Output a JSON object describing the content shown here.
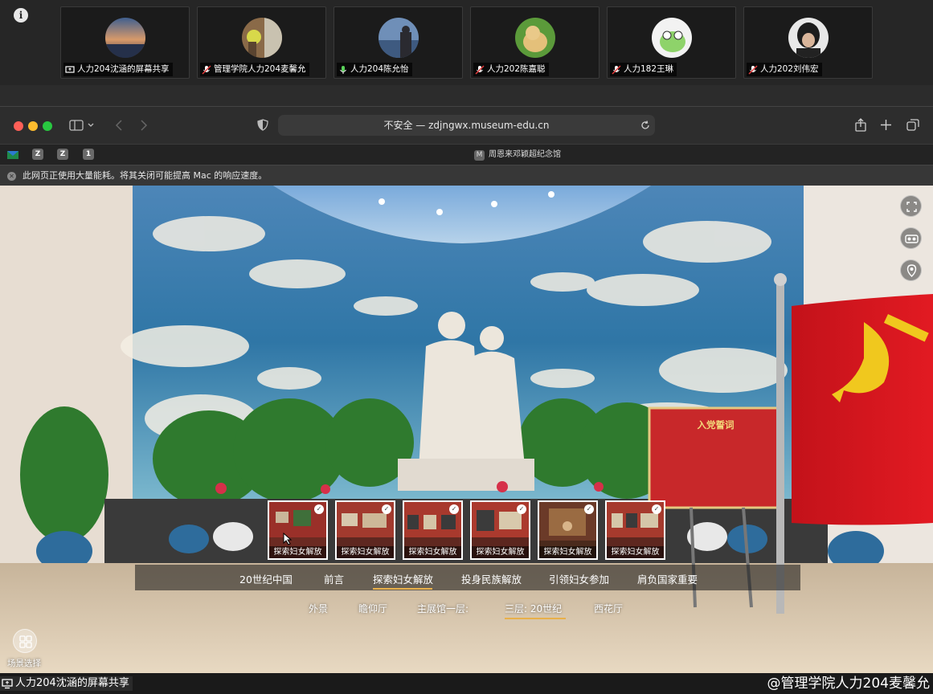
{
  "meeting": {
    "info_icon": "info-icon",
    "participants": [
      {
        "name": "人力204沈涵的屏幕共享",
        "status_icon": "screen-share-icon"
      },
      {
        "name": "管理学院人力204麦馨允",
        "status_icon": "mic-muted-icon"
      },
      {
        "name": "人力204陈允怡",
        "status_icon": "mic-on-icon"
      },
      {
        "name": "人力202陈嘉聪",
        "status_icon": "mic-muted-icon"
      },
      {
        "name": "人力182王琳",
        "status_icon": "mic-muted-icon"
      },
      {
        "name": "人力202刘伟宏",
        "status_icon": "mic-muted-icon"
      }
    ],
    "share_label": "人力204沈涵的屏幕共享",
    "speaker_label": "@管理学院人力204麦馨允"
  },
  "browser": {
    "url": "不安全 — zdjngwx.museum-edu.cn",
    "tab_icons": [
      "Z",
      "Z",
      "1"
    ],
    "active_tab_badge": "M",
    "active_tab_title": "周恩来邓颖超纪念馆",
    "banner": "此网页正使用大量能耗。将其关闭可能提高 Mac 的响应速度。"
  },
  "tour": {
    "oath_title": "入党誓词",
    "thumbnails": [
      "探索妇女解放",
      "探索妇女解放",
      "探索妇女解放",
      "探索妇女解放",
      "探索妇女解放",
      "探索妇女解放"
    ],
    "nav1": [
      "20世纪中国",
      "前言",
      "探索妇女解放",
      "投身民族解放",
      "引领妇女参加",
      "肩负国家重要"
    ],
    "nav1_active": "探索妇女解放",
    "nav2": [
      "外景",
      "瞻仰厅",
      "主展馆一层:",
      "三层: 20世纪",
      "西花厅"
    ],
    "nav2_active": "三层: 20世纪",
    "scene_select_label": "场景选择"
  },
  "colors": {
    "flag_red": "#d8141a",
    "accent_underline": "#e8b04a"
  }
}
